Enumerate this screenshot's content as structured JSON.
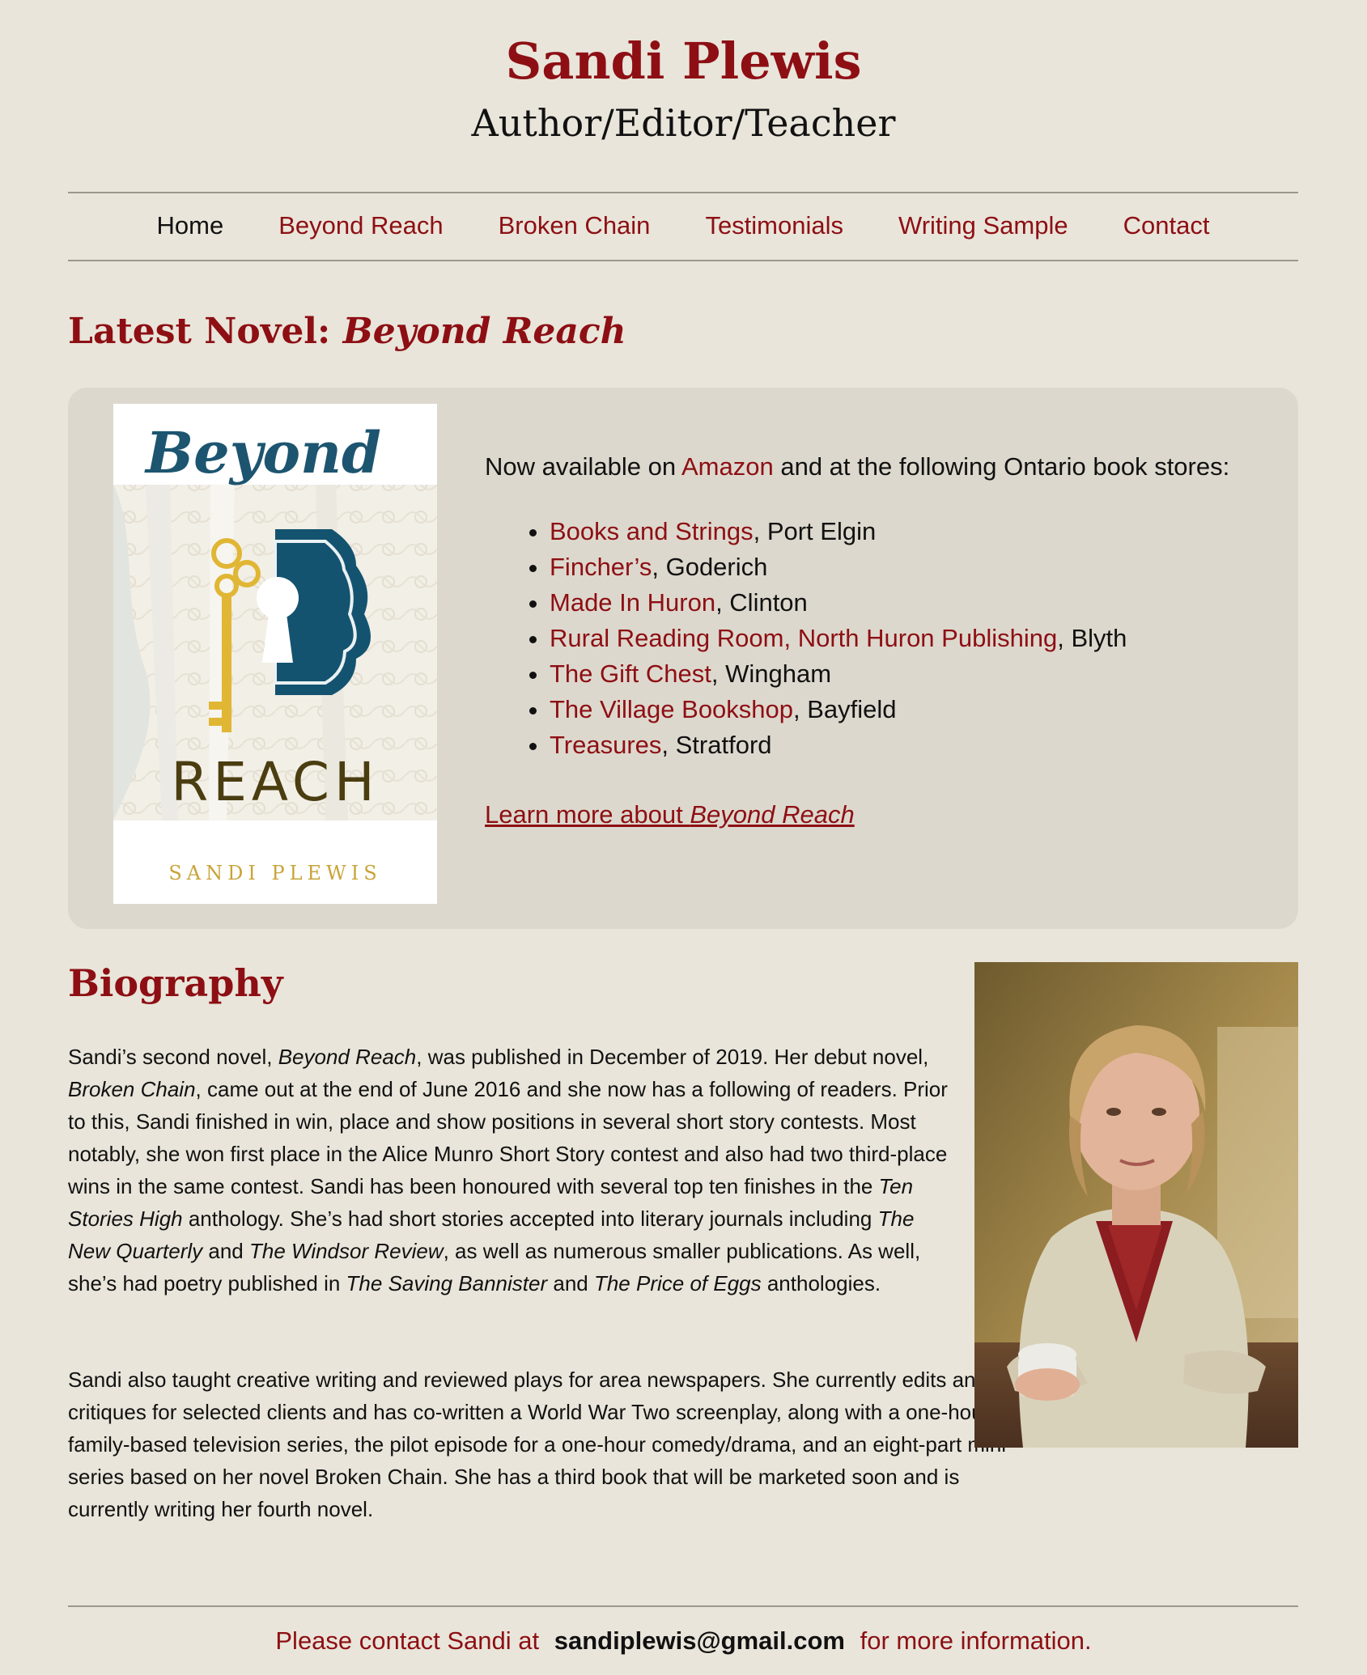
{
  "site": {
    "title": "Sandi Plewis",
    "subtitle": "Author/Editor/Teacher"
  },
  "nav": {
    "items": [
      {
        "label": "Home",
        "current": true
      },
      {
        "label": "Beyond Reach"
      },
      {
        "label": "Broken Chain"
      },
      {
        "label": "Testimonials"
      },
      {
        "label": "Writing Sample"
      },
      {
        "label": "Contact"
      }
    ]
  },
  "latest": {
    "heading_prefix": "Latest Novel: ",
    "heading_title": "Beyond Reach",
    "cover": {
      "title_top": "Beyond",
      "title_bottom": "REACH",
      "author": "SANDI PLEWIS",
      "colors": {
        "title_top": "#1d5570",
        "keyhole": "#14536f",
        "key": "#e0b634",
        "title_bottom": "#4a3d10",
        "author": "#c9a43a"
      }
    },
    "availability": {
      "prefix": "Now available on ",
      "link": "Amazon",
      "suffix": " and at the following Ontario book stores:"
    },
    "stores": [
      {
        "name": "Books and Strings",
        "town": ", Port Elgin"
      },
      {
        "name": "Fincher’s",
        "town": ", Goderich"
      },
      {
        "name": "Made In Huron",
        "town": ", Clinton"
      },
      {
        "name": "Rural Reading Room, North Huron Publishing",
        "town": ", Blyth"
      },
      {
        "name": "The Gift Chest",
        "town": ", Wingham"
      },
      {
        "name": "The Village Bookshop",
        "town": ", Bayfield"
      },
      {
        "name": "Treasures",
        "town": ", Stratford"
      }
    ],
    "learn_more": {
      "prefix": "Learn more about ",
      "title": "Beyond Reach"
    }
  },
  "biography": {
    "heading": "Biography",
    "p1": [
      {
        "t": "Sandi’s second novel, "
      },
      {
        "t": "Beyond Reach",
        "i": true
      },
      {
        "t": ", was published in December of 2019. Her debut novel, "
      },
      {
        "t": "Broken Chain",
        "i": true
      },
      {
        "t": ", came out at the end of June 2016 and she now has a following of readers. Prior to this, Sandi finished in win, place and show positions in several short story contests. Most notably, she won first place in the Alice Munro Short Story contest and also had two third-place wins in the same contest. Sandi has been honoured with several top ten finishes in the "
      },
      {
        "t": "Ten Stories High",
        "i": true
      },
      {
        "t": " anthology. She’s had short stories accepted into literary journals including "
      },
      {
        "t": "The New Quarterly",
        "i": true
      },
      {
        "t": " and "
      },
      {
        "t": "The Windsor Review",
        "i": true
      },
      {
        "t": ", as well as numerous smaller publications. As well, she’s had poetry published in "
      },
      {
        "t": "The Saving Bannister",
        "i": true
      },
      {
        "t": " and "
      },
      {
        "t": "The Price of Eggs",
        "i": true
      },
      {
        "t": " anthologies."
      }
    ],
    "p2": "Sandi also taught creative writing and reviewed plays for area newspapers. She currently edits and critiques for selected clients and has co-written a World War Two screenplay, along with a one-hour family-based television series, the pilot episode for a one-hour comedy/drama, and an eight-part mini-series based on her novel Broken Chain. She has a third book that will be marketed soon and is currently writing her fourth novel."
  },
  "footer": {
    "prefix": "Please contact Sandi at",
    "email": "sandiplewis@gmail.com",
    "suffix": "for more information."
  },
  "colors": {
    "background": "#e9e5da",
    "panel": "#ddd8cd",
    "accent": "#8d0f14",
    "text": "#111111"
  }
}
